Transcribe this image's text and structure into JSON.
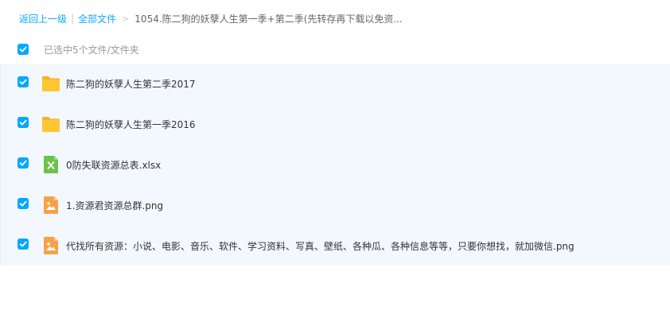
{
  "breadcrumb": {
    "back_label": "返回上一级",
    "separator": "|",
    "all_files_label": "全部文件",
    "arrow": ">",
    "current": "1054.陈二狗的妖孽人生第一季+第二季(先转存再下载以免资..."
  },
  "selection": {
    "text": "已选中5个文件/文件夹",
    "checked": true
  },
  "files": [
    {
      "name": "陈二狗的妖孽人生第二季2017",
      "type": "folder",
      "icon": "folder-icon",
      "checked": true
    },
    {
      "name": "陈二狗的妖孽人生第一季2016",
      "type": "folder",
      "icon": "folder-icon",
      "checked": true
    },
    {
      "name": "0防失联资源总表.xlsx",
      "type": "excel",
      "icon": "excel-file-icon",
      "checked": true
    },
    {
      "name": "1.资源君资源总群.png",
      "type": "image",
      "icon": "image-file-icon",
      "checked": true
    },
    {
      "name": "代找所有资源：小说、电影、音乐、软件、学习资料、写真、壁纸、各种瓜、各种信息等等，只要你想找，就加微信.png",
      "type": "image",
      "icon": "image-file-icon",
      "checked": true
    }
  ],
  "colors": {
    "accent": "#06a7ff",
    "link": "#09aaff",
    "list_bg": "#f3f8fe",
    "folder": "#ffc533",
    "excel": "#6cc24a",
    "image": "#f9a14a"
  }
}
